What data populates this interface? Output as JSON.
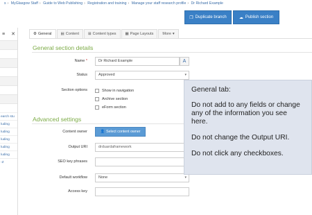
{
  "breadcrumb": [
    "s",
    "MyGlasgow Staff",
    "Guide to Web Publishing",
    "Registration and training",
    "Manage your staff research profile",
    "Dr Richard Example"
  ],
  "toolbar": {
    "duplicate_label": "Duplicate branch",
    "publish_label": "Publish section"
  },
  "sidebar": {
    "close_glyph": "✕",
    "items": [
      "earch stu",
      "luding",
      "luding",
      "luding",
      "luding",
      "luding",
      "-Z"
    ]
  },
  "tabs": [
    {
      "label": "General",
      "icon": "gear-icon",
      "active": true
    },
    {
      "label": "Content",
      "icon": "document-icon",
      "active": false
    },
    {
      "label": "Content types",
      "icon": "grid-icon",
      "active": false
    },
    {
      "label": "Page Layouts",
      "icon": "layout-icon",
      "active": false
    },
    {
      "label": "More",
      "icon": "chevron-down-icon",
      "active": false
    }
  ],
  "general": {
    "title": "General section details",
    "name_label": "Name",
    "name_required": "*",
    "name_value": "Dr Richard Example",
    "status_label": "Status",
    "status_value": "Approved",
    "options_label": "Section options",
    "options": [
      "Show in navigation",
      "Archive section",
      "eForm section"
    ]
  },
  "advanced": {
    "title": "Advanced settings",
    "owner_label": "Content owner",
    "owner_button": "Select content owner",
    "uri_label": "Output URI",
    "uri_value": "drduardaframework",
    "seo_label": "SEO key phrases",
    "seo_value": "",
    "workflow_label": "Default workflow",
    "workflow_value": "None",
    "access_label": "Access key",
    "access_value": ""
  },
  "callout": {
    "title": "General tab:",
    "line1": "Do not add to any fields or change any of the information you see here.",
    "line2": "Do not change the Output URI.",
    "line3": "Do not click any checkboxes."
  },
  "colors": {
    "accent_blue": "#3a80c6",
    "section_green": "#7cab46",
    "callout_bg": "#dfe4ee"
  }
}
